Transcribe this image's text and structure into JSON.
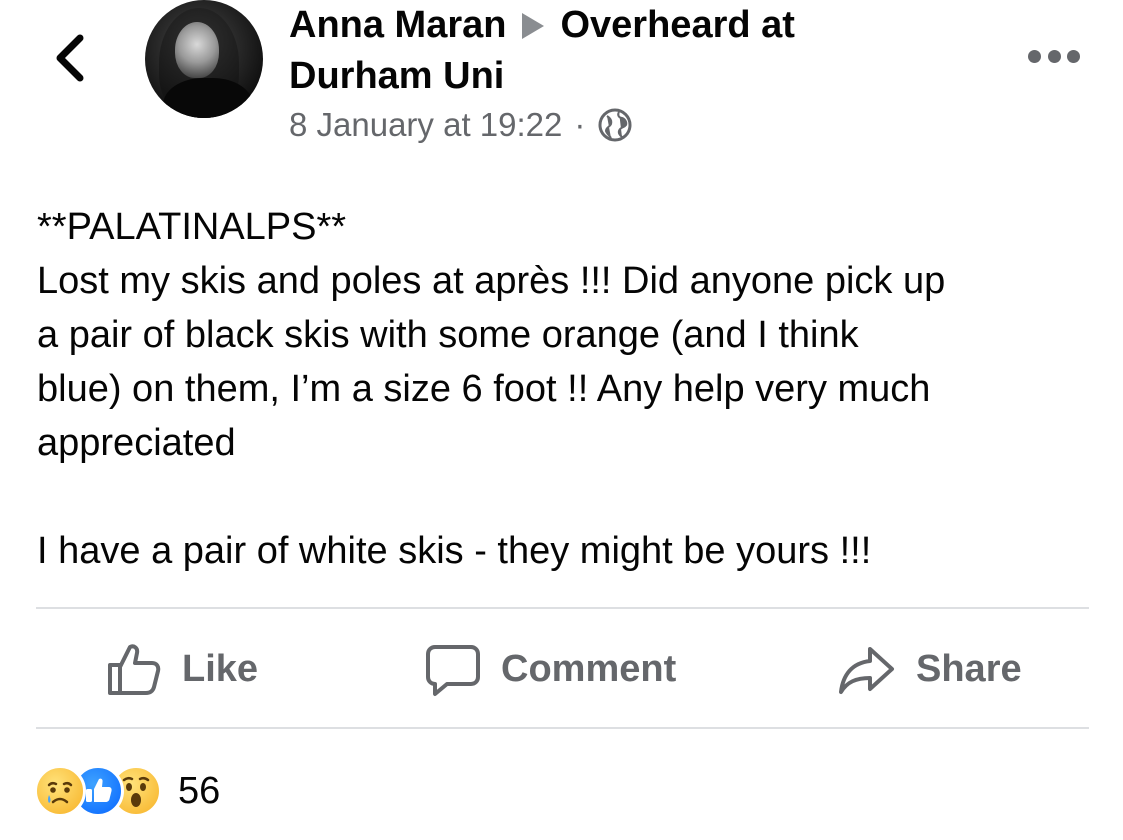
{
  "post": {
    "author": "Anna Maran",
    "group": "Overheard at Durham Uni",
    "timestamp": "8 January at 19:22",
    "separator": "·",
    "privacy_icon": "globe-icon",
    "text_lines": [
      "**PALATINALPS**",
      "Lost my skis and poles at après !!! Did anyone pick up",
      "a pair of black skis with some orange (and I think",
      "blue) on them, I’m a size 6 foot !! Any help very much",
      "appreciated"
    ],
    "text_after_break": "I have a pair of white skis - they might be yours !!!"
  },
  "actions": {
    "like_label": "Like",
    "comment_label": "Comment",
    "share_label": "Share"
  },
  "reactions": {
    "icons": [
      "sad-reaction-icon",
      "like-reaction-icon",
      "wow-reaction-icon"
    ],
    "count": "56"
  },
  "colors": {
    "secondary_text": "#65676b",
    "like_blue": "#0866ff",
    "divider": "#dddfe2"
  }
}
